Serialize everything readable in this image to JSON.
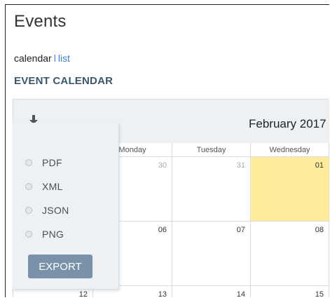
{
  "page": {
    "title": "Events"
  },
  "view_switch": {
    "calendar_label": "calendar",
    "separator": "l",
    "list_label": "list"
  },
  "section": {
    "heading": "EVENT CALENDAR"
  },
  "calendar": {
    "month_title": "February 2017",
    "day_headers": [
      "Monday",
      "Tuesday",
      "Wednesday"
    ],
    "weeks": [
      [
        "30",
        "31",
        "01"
      ],
      [
        "06",
        "07",
        "08"
      ],
      [
        "12",
        "13",
        "14",
        "15"
      ]
    ],
    "today_color": "#fcec9c"
  },
  "export_menu": {
    "options": [
      "PDF",
      "XML",
      "JSON",
      "PNG"
    ],
    "button_label": "EXPORT",
    "button_color": "#7991a9"
  },
  "icons": {
    "download": "download-tray-icon"
  }
}
